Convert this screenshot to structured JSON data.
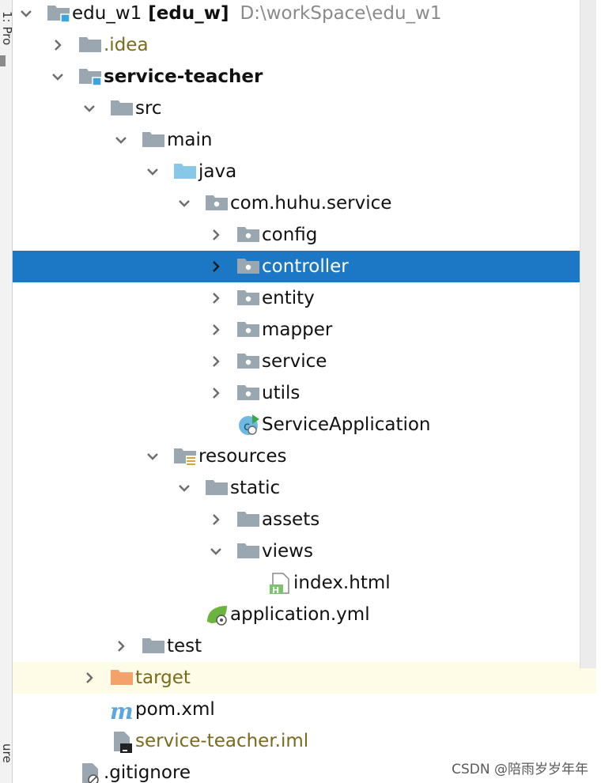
{
  "side_tabs": {
    "top_label": "1: Pro",
    "bottom_label": "ure"
  },
  "tree": {
    "rows": [
      {
        "depth": 0,
        "arrow": "down",
        "icon": "module-folder-icon",
        "label": "edu_w1",
        "extra": "[edu_w]",
        "path": "D:\\workSpace\\edu_w1",
        "style": "normal"
      },
      {
        "depth": 1,
        "arrow": "right",
        "icon": "folder-icon",
        "label": ".idea",
        "style": "olive"
      },
      {
        "depth": 1,
        "arrow": "down",
        "icon": "module-folder-icon",
        "label": "service-teacher",
        "style": "bold"
      },
      {
        "depth": 2,
        "arrow": "down",
        "icon": "folder-icon",
        "label": "src",
        "style": "normal"
      },
      {
        "depth": 3,
        "arrow": "down",
        "icon": "folder-icon",
        "label": "main",
        "style": "normal"
      },
      {
        "depth": 4,
        "arrow": "down",
        "icon": "source-folder-icon",
        "label": "java",
        "style": "normal"
      },
      {
        "depth": 5,
        "arrow": "down",
        "icon": "package-icon",
        "label": "com.huhu.service",
        "style": "normal"
      },
      {
        "depth": 6,
        "arrow": "right",
        "icon": "package-icon",
        "label": "config",
        "style": "normal"
      },
      {
        "depth": 6,
        "arrow": "right",
        "icon": "package-icon",
        "label": "controller",
        "style": "normal",
        "selected": true
      },
      {
        "depth": 6,
        "arrow": "right",
        "icon": "package-icon",
        "label": "entity",
        "style": "normal"
      },
      {
        "depth": 6,
        "arrow": "right",
        "icon": "package-icon",
        "label": "mapper",
        "style": "normal"
      },
      {
        "depth": 6,
        "arrow": "right",
        "icon": "package-icon",
        "label": "service",
        "style": "normal"
      },
      {
        "depth": 6,
        "arrow": "right",
        "icon": "package-icon",
        "label": "utils",
        "style": "normal"
      },
      {
        "depth": 6,
        "arrow": "none",
        "icon": "spring-class-icon",
        "label": "ServiceApplication",
        "style": "normal"
      },
      {
        "depth": 4,
        "arrow": "down",
        "icon": "resources-folder-icon",
        "label": "resources",
        "style": "normal"
      },
      {
        "depth": 5,
        "arrow": "down",
        "icon": "folder-icon",
        "label": "static",
        "style": "normal"
      },
      {
        "depth": 6,
        "arrow": "right",
        "icon": "folder-icon",
        "label": "assets",
        "style": "normal"
      },
      {
        "depth": 6,
        "arrow": "down",
        "icon": "folder-icon",
        "label": "views",
        "style": "normal"
      },
      {
        "depth": 7,
        "arrow": "none",
        "icon": "html-file-icon",
        "label": "index.html",
        "style": "normal"
      },
      {
        "depth": 5,
        "arrow": "none",
        "icon": "spring-yml-icon",
        "label": "application.yml",
        "style": "normal"
      },
      {
        "depth": 3,
        "arrow": "right",
        "icon": "folder-icon",
        "label": "test",
        "style": "normal"
      },
      {
        "depth": 2,
        "arrow": "right",
        "icon": "excluded-folder-icon",
        "label": "target",
        "style": "olive",
        "ignored": true
      },
      {
        "depth": 2,
        "arrow": "none",
        "icon": "maven-icon",
        "label": "pom.xml",
        "style": "normal"
      },
      {
        "depth": 2,
        "arrow": "none",
        "icon": "iml-file-icon",
        "label": "service-teacher.iml",
        "style": "olive"
      },
      {
        "depth": 1,
        "arrow": "none",
        "icon": "gitignore-file-icon",
        "label": ".gitignore",
        "style": "normal"
      }
    ]
  },
  "watermark": "CSDN @陪雨岁岁年年",
  "colors": {
    "selection": "#1c78c4",
    "ignored_bg": "#fefce6",
    "folder": "#9aa7b0",
    "source_folder": "#87c7e8",
    "excluded_folder": "#f4a26c",
    "module_badge": "#3aa6dd",
    "olive_text": "#7a6a1e"
  }
}
